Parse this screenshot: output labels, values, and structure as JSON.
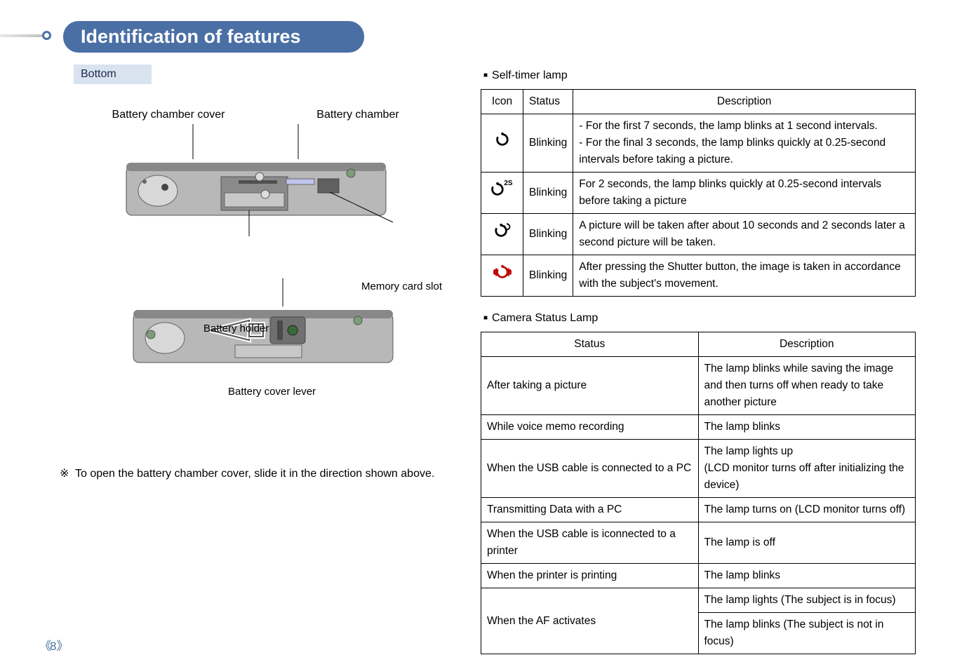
{
  "title": "Identification of features",
  "bottom_label": "Bottom",
  "callouts": {
    "battery_cover": "Battery chamber cover",
    "battery_chamber": "Battery chamber",
    "memory_slot": "Memory card slot",
    "battery_holder": "Battery holder",
    "cover_lever": "Battery cover lever"
  },
  "note_prefix": "※",
  "note": "To open the battery chamber cover, slide it in the direction shown above.",
  "self_timer": {
    "heading": "Self-timer lamp",
    "headers": {
      "icon": "Icon",
      "status": "Status",
      "desc": "Description"
    },
    "rows": [
      {
        "icon_sup": "",
        "status": "Blinking",
        "desc": "- For the first 7 seconds, the lamp blinks at 1 second intervals.\n- For the final 3 seconds, the lamp blinks quickly at 0.25-second intervals before taking a picture."
      },
      {
        "icon_sup": "2S",
        "status": "Blinking",
        "desc": "For 2 seconds, the lamp blinks quickly at 0.25-second intervals before taking a picture"
      },
      {
        "icon_sup": "ره",
        "status": "Blinking",
        "desc": "A picture will be taken after about 10 seconds and 2 seconds later a second picture will be taken."
      },
      {
        "icon_sup": "motion",
        "status": "Blinking",
        "desc": "After pressing the Shutter button, the image is taken in accordance with the subject's movement."
      }
    ]
  },
  "camera_status": {
    "heading": "Camera Status Lamp",
    "headers": {
      "status": "Status",
      "desc": "Description"
    },
    "rows": [
      {
        "status": "After taking a picture",
        "desc": "The lamp blinks while saving the image and then turns off when ready to take another picture"
      },
      {
        "status": "While voice memo recording",
        "desc": "The lamp blinks"
      },
      {
        "status": "When the USB cable is connected to a PC",
        "desc": "The lamp lights up\n(LCD monitor turns off after initializing the device)"
      },
      {
        "status": "Transmitting Data with a PC",
        "desc": "The lamp turns on (LCD monitor turns off)"
      },
      {
        "status": "When the USB cable is iconnected to a printer",
        "desc": "The lamp is off"
      },
      {
        "status": "When the printer is printing",
        "desc": "The lamp blinks"
      },
      {
        "status": "When the AF activates",
        "desc_a": "The lamp lights (The subject is in focus)",
        "desc_b": "The lamp blinks (The subject is not in focus)"
      }
    ]
  },
  "page_number": "8"
}
